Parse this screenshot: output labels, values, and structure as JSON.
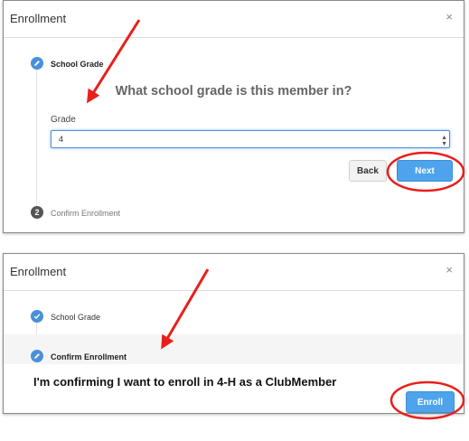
{
  "panel1": {
    "title": "Enrollment",
    "close": "×",
    "steps": [
      {
        "label": "School Grade",
        "state": "active"
      },
      {
        "label": "Confirm Enrollment",
        "state": "pending",
        "number": "2"
      }
    ],
    "question": "What school grade is this member in?",
    "grade_label": "Grade",
    "grade_value": "4",
    "back_label": "Back",
    "next_label": "Next"
  },
  "panel2": {
    "title": "Enrollment",
    "close": "×",
    "steps": [
      {
        "label": "School Grade",
        "state": "done"
      },
      {
        "label": "Confirm Enrollment",
        "state": "active"
      }
    ],
    "confirm_text": "I'm confirming I want to enroll in 4-H as a ClubMember",
    "enroll_label": "Enroll"
  },
  "colors": {
    "accent": "#4da3ec",
    "annotation": "#e8201c"
  }
}
